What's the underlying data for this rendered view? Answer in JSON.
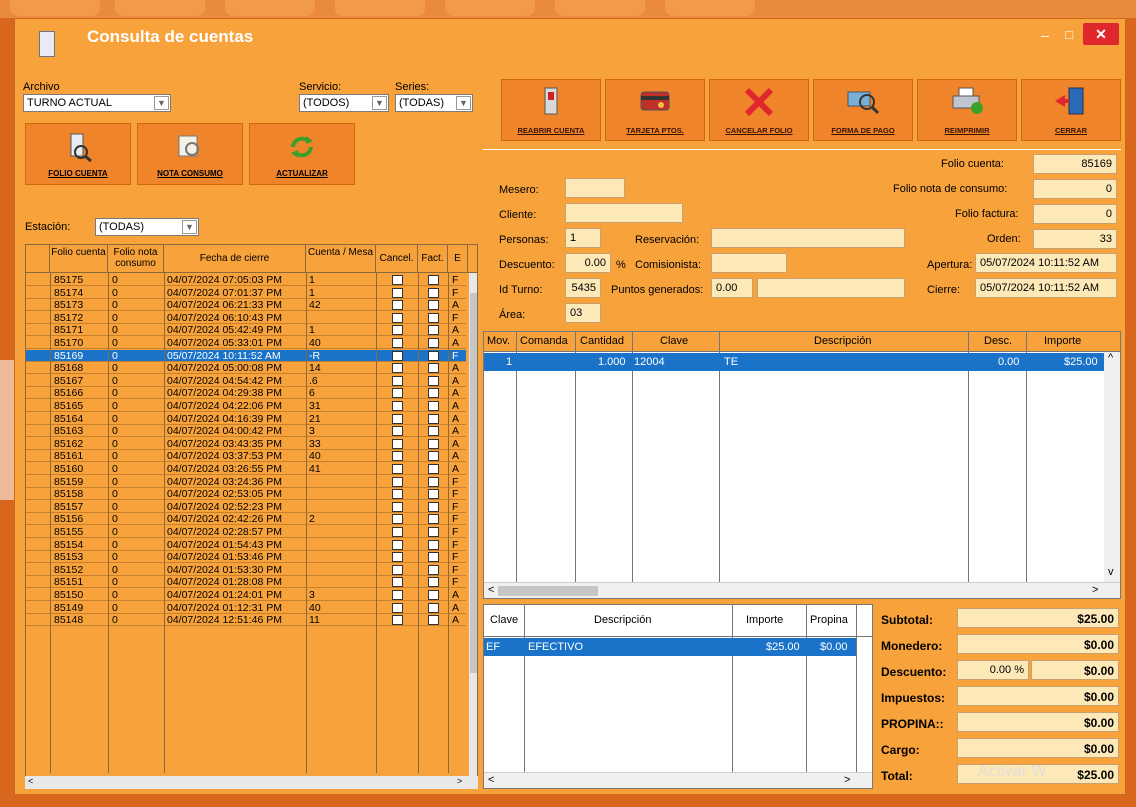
{
  "window": {
    "title": "Consulta de cuentas"
  },
  "filters": {
    "archivo_label": "Archivo",
    "archivo_value": "TURNO ACTUAL",
    "servicio_label": "Servicio:",
    "servicio_value": "(TODOS)",
    "series_label": "Series:",
    "series_value": "(TODAS)",
    "estacion_label": "Estación:",
    "estacion_value": "(TODAS)"
  },
  "left_buttons": {
    "folio_cuenta": "FOLIO CUENTA",
    "nota_consumo": "NOTA CONSUMO",
    "actualizar": "ACTUALIZAR"
  },
  "right_buttons": {
    "reabrir": "REABRIR CUENTA",
    "tarjeta": "TARJETA PTOS.",
    "cancelar": "CANCELAR FOLIO",
    "forma_pago": "FORMA DE PAGO",
    "reimprimir": "REIMPRIMIR",
    "cerrar": "CERRAR"
  },
  "accounts_table": {
    "headers": {
      "folio": "Folio cuenta",
      "nota": "Folio nota consumo",
      "fecha": "Fecha de cierre",
      "mesa": "Cuenta / Mesa",
      "cancel": "Cancel.",
      "fact": "Fact.",
      "e": "E"
    },
    "rows": [
      {
        "folio": "85175",
        "nota": "0",
        "fecha": "04/07/2024 07:05:03 PM",
        "mesa": "1",
        "e": "F"
      },
      {
        "folio": "85174",
        "nota": "0",
        "fecha": "04/07/2024 07:01:37 PM",
        "mesa": "1",
        "e": "F"
      },
      {
        "folio": "85173",
        "nota": "0",
        "fecha": "04/07/2024 06:21:33 PM",
        "mesa": "42",
        "e": "A"
      },
      {
        "folio": "85172",
        "nota": "0",
        "fecha": "04/07/2024 06:10:43 PM",
        "mesa": "",
        "e": "F"
      },
      {
        "folio": "85171",
        "nota": "0",
        "fecha": "04/07/2024 05:42:49 PM",
        "mesa": "1",
        "e": "A"
      },
      {
        "folio": "85170",
        "nota": "0",
        "fecha": "04/07/2024 05:33:01 PM",
        "mesa": "40",
        "e": "A"
      },
      {
        "folio": "85169",
        "nota": "0",
        "fecha": "05/07/2024 10:11:52 AM",
        "mesa": "-R",
        "e": "F",
        "selected": true
      },
      {
        "folio": "85168",
        "nota": "0",
        "fecha": "04/07/2024 05:00:08 PM",
        "mesa": "14",
        "e": "A"
      },
      {
        "folio": "85167",
        "nota": "0",
        "fecha": "04/07/2024 04:54:42 PM",
        "mesa": ".6",
        "e": "A"
      },
      {
        "folio": "85166",
        "nota": "0",
        "fecha": "04/07/2024 04:29:38 PM",
        "mesa": "6",
        "e": "A"
      },
      {
        "folio": "85165",
        "nota": "0",
        "fecha": "04/07/2024 04:22:06 PM",
        "mesa": "31",
        "e": "A"
      },
      {
        "folio": "85164",
        "nota": "0",
        "fecha": "04/07/2024 04:16:39 PM",
        "mesa": "21",
        "e": "A"
      },
      {
        "folio": "85163",
        "nota": "0",
        "fecha": "04/07/2024 04:00:42 PM",
        "mesa": "3",
        "e": "A"
      },
      {
        "folio": "85162",
        "nota": "0",
        "fecha": "04/07/2024 03:43:35 PM",
        "mesa": "33",
        "e": "A"
      },
      {
        "folio": "85161",
        "nota": "0",
        "fecha": "04/07/2024 03:37:53 PM",
        "mesa": "40",
        "e": "A"
      },
      {
        "folio": "85160",
        "nota": "0",
        "fecha": "04/07/2024 03:26:55 PM",
        "mesa": "41",
        "e": "A"
      },
      {
        "folio": "85159",
        "nota": "0",
        "fecha": "04/07/2024 03:24:36 PM",
        "mesa": "",
        "e": "F"
      },
      {
        "folio": "85158",
        "nota": "0",
        "fecha": "04/07/2024 02:53:05 PM",
        "mesa": "",
        "e": "F"
      },
      {
        "folio": "85157",
        "nota": "0",
        "fecha": "04/07/2024 02:52:23 PM",
        "mesa": "",
        "e": "F"
      },
      {
        "folio": "85156",
        "nota": "0",
        "fecha": "04/07/2024 02:42:26 PM",
        "mesa": "2",
        "e": "F"
      },
      {
        "folio": "85155",
        "nota": "0",
        "fecha": "04/07/2024 02:28:57 PM",
        "mesa": "",
        "e": "F"
      },
      {
        "folio": "85154",
        "nota": "0",
        "fecha": "04/07/2024 01:54:43 PM",
        "mesa": "",
        "e": "F"
      },
      {
        "folio": "85153",
        "nota": "0",
        "fecha": "04/07/2024 01:53:46 PM",
        "mesa": "",
        "e": "F"
      },
      {
        "folio": "85152",
        "nota": "0",
        "fecha": "04/07/2024 01:53:30 PM",
        "mesa": "",
        "e": "F"
      },
      {
        "folio": "85151",
        "nota": "0",
        "fecha": "04/07/2024 01:28:08 PM",
        "mesa": "",
        "e": "F"
      },
      {
        "folio": "85150",
        "nota": "0",
        "fecha": "04/07/2024 01:24:01 PM",
        "mesa": "3",
        "e": "A"
      },
      {
        "folio": "85149",
        "nota": "0",
        "fecha": "04/07/2024 01:12:31 PM",
        "mesa": "40",
        "e": "A"
      },
      {
        "folio": "85148",
        "nota": "0",
        "fecha": "04/07/2024 12:51:46 PM",
        "mesa": "11",
        "e": "A"
      }
    ]
  },
  "info": {
    "folio_cuenta_label": "Folio cuenta:",
    "folio_cuenta": "85169",
    "mesero_label": "Mesero:",
    "folio_nota_label": "Folio nota de consumo:",
    "folio_nota": "0",
    "cliente_label": "Cliente:",
    "folio_factura_label": "Folio factura:",
    "folio_factura": "0",
    "personas_label": "Personas:",
    "personas": "1",
    "reservacion_label": "Reservación:",
    "orden_label": "Orden:",
    "orden": "33",
    "descuento_label": "Descuento:",
    "descuento": "0.00",
    "pct": "%",
    "comisionista_label": "Comisionista:",
    "apertura_label": "Apertura:",
    "apertura": "05/07/2024 10:11:52 AM",
    "idturno_label": "Id Turno:",
    "idturno": "5435",
    "puntos_label": "Puntos generados:",
    "puntos": "0.00",
    "cierre_label": "Cierre:",
    "cierre": "05/07/2024 10:11:52 AM",
    "area_label": "Área:",
    "area": "03"
  },
  "items_table": {
    "headers": {
      "mov": "Mov.",
      "comanda": "Comanda",
      "cantidad": "Cantidad",
      "clave": "Clave",
      "descripcion": "Descripción",
      "desc": "Desc.",
      "importe": "Importe"
    },
    "rows": [
      {
        "mov": "1",
        "comanda": "",
        "cantidad": "1.000",
        "clave": "12004",
        "descripcion": "TE",
        "desc": "0.00",
        "importe": "$25.00"
      }
    ]
  },
  "payments_table": {
    "headers": {
      "clave": "Clave",
      "descripcion": "Descripción",
      "importe": "Importe",
      "propina": "Propina"
    },
    "rows": [
      {
        "clave": "EF",
        "descripcion": "EFECTIVO",
        "importe": "$25.00",
        "propina": "$0.00"
      }
    ]
  },
  "totals": {
    "subtotal_label": "Subtotal:",
    "subtotal": "$25.00",
    "monedero_label": "Monedero:",
    "monedero": "$0.00",
    "descuento_label": "Descuento:",
    "descuento_pct": "0.00 %",
    "descuento": "$0.00",
    "impuestos_label": "Impuestos:",
    "impuestos": "$0.00",
    "propina_label": "PROPINA::",
    "propina": "$0.00",
    "cargo_label": "Cargo:",
    "cargo": "$0.00",
    "total_label": "Total:",
    "total": "$25.00"
  },
  "watermark": "Activar W",
  "colors": {
    "accent": "#f7a23a",
    "button": "#f0842a",
    "selection": "#1a73c8",
    "field": "#fde8b8",
    "close": "#e0282c"
  }
}
